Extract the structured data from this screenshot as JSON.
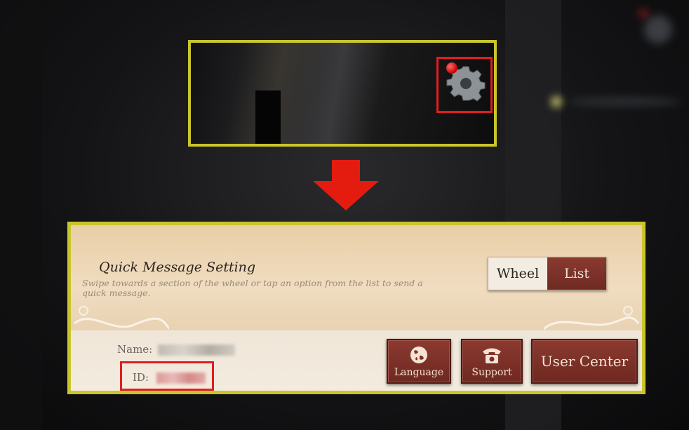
{
  "top_panel": {
    "settings_icon": "gear-icon",
    "notification": "red-dot"
  },
  "arrow": {
    "icon": "down-arrow-icon",
    "color": "#e41b0f"
  },
  "quick_message": {
    "title": "Quick Message Setting",
    "description": "Swipe towards a section of the wheel or tap an option from the list to send a quick message.",
    "toggle": {
      "options": [
        "Wheel",
        "List"
      ],
      "selected": "List"
    }
  },
  "account": {
    "name_label": "Name:",
    "id_label": "ID:"
  },
  "buttons": {
    "language": {
      "label": "Language",
      "icon": "globe-icon"
    },
    "support": {
      "label": "Support",
      "icon": "telephone-icon"
    },
    "user_center": {
      "label": "User Center"
    }
  },
  "colors": {
    "highlight_border": "#c9c52c",
    "callout_red": "#e01e1e",
    "button_bg": "#7a3027"
  }
}
